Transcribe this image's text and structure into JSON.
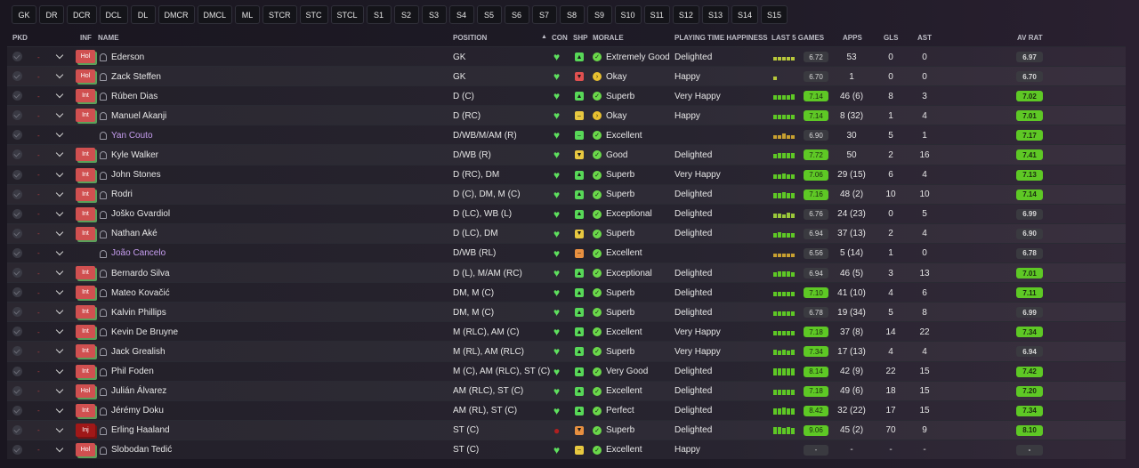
{
  "position_filters": [
    "GK",
    "DR",
    "DCR",
    "DCL",
    "DL",
    "DMCR",
    "DMCL",
    "ML",
    "STCR",
    "STC",
    "STCL",
    "S1",
    "S2",
    "S3",
    "S4",
    "S5",
    "S6",
    "S7",
    "S8",
    "S9",
    "S10",
    "S11",
    "S12",
    "S13",
    "S14",
    "S15"
  ],
  "headers": {
    "pkd": "PKD",
    "inf": "INF",
    "name": "NAME",
    "position": "POSITION",
    "sort_arrow": "▲",
    "con": "CON",
    "shp": "SHP",
    "morale": "MORALE",
    "pth": "PLAYING TIME HAPPINESS",
    "last5": "LAST 5 GAMES",
    "apps": "APPS",
    "gls": "GLS",
    "ast": "AST",
    "avrat": "AV RAT"
  },
  "colors": {
    "rating_green": "#5ec825",
    "rating_yellowgreen": "#b8c83a",
    "rating_grey": "#3a3a40",
    "shp_green": "#58d858",
    "shp_red": "#e05050",
    "shp_yellow": "#e8c840",
    "shp_orange": "#e89040",
    "morale_green": "#6ad84a",
    "morale_yellow": "#e8c030"
  },
  "players": [
    {
      "inf": "Hol",
      "name": "Ederson",
      "loan": false,
      "position": "GK",
      "con_red": false,
      "shp": "green",
      "shp_icon": "▲",
      "morale": "Extremely Good",
      "morale_color": "green",
      "pth": "Delighted",
      "last5": [
        0.5,
        0.5,
        0.5,
        0.5,
        0.5
      ],
      "last5_color": "#b8c83a",
      "last5_rating": "6.72",
      "rating_style": "grey",
      "apps": "53",
      "gls": "0",
      "ast": "0",
      "avrat": "6.97",
      "av_style": "grey"
    },
    {
      "inf": "Hol",
      "name": "Zack Steffen",
      "loan": false,
      "position": "GK",
      "con_red": false,
      "shp": "red",
      "shp_icon": "▼",
      "morale": "Okay",
      "morale_color": "yellow",
      "pth": "Happy",
      "last5": [
        0.5
      ],
      "last5_color": "#b8c83a",
      "last5_rating": "6.70",
      "rating_style": "grey",
      "apps": "1",
      "gls": "0",
      "ast": "0",
      "avrat": "6.70",
      "av_style": "grey"
    },
    {
      "inf": "Int",
      "name": "Rúben Dias",
      "loan": false,
      "position": "D (C)",
      "con_red": false,
      "shp": "green",
      "shp_icon": "▲",
      "morale": "Superb",
      "morale_color": "green",
      "pth": "Very Happy",
      "last5": [
        0.7,
        0.7,
        0.7,
        0.7,
        0.8
      ],
      "last5_color": "#5ec825",
      "last5_rating": "7.14",
      "rating_style": "green",
      "apps": "46 (6)",
      "gls": "8",
      "ast": "3",
      "avrat": "7.02",
      "av_style": "green"
    },
    {
      "inf": "Int",
      "name": "Manuel Akanji",
      "loan": false,
      "position": "D (RC)",
      "con_red": false,
      "shp": "yellow",
      "shp_icon": "–",
      "morale": "Okay",
      "morale_color": "yellow",
      "pth": "Happy",
      "last5": [
        0.7,
        0.7,
        0.7,
        0.7,
        0.7
      ],
      "last5_color": "#5ec825",
      "last5_rating": "7.14",
      "rating_style": "green",
      "apps": "8 (32)",
      "gls": "1",
      "ast": "4",
      "avrat": "7.01",
      "av_style": "green"
    },
    {
      "inf": "",
      "name": "Yan Couto",
      "loan": true,
      "position": "D/WB/M/AM (R)",
      "con_red": false,
      "shp": "green",
      "shp_icon": "–",
      "morale": "Excellent",
      "morale_color": "green",
      "pth": "",
      "last5": [
        0.5,
        0.6,
        0.8,
        0.6,
        0.5
      ],
      "last5_color": "#c8a030",
      "last5_rating": "6.90",
      "rating_style": "grey",
      "apps": "30",
      "gls": "5",
      "ast": "1",
      "avrat": "7.17",
      "av_style": "green"
    },
    {
      "inf": "Int",
      "name": "Kyle Walker",
      "loan": false,
      "position": "D/WB (R)",
      "con_red": false,
      "shp": "yellow",
      "shp_icon": "▼",
      "morale": "Good",
      "morale_color": "green",
      "pth": "Delighted",
      "last5": [
        0.7,
        0.8,
        0.8,
        0.8,
        0.8
      ],
      "last5_color": "#5ec825",
      "last5_rating": "7.72",
      "rating_style": "green",
      "apps": "50",
      "gls": "2",
      "ast": "16",
      "avrat": "7.41",
      "av_style": "green"
    },
    {
      "inf": "Int",
      "name": "John Stones",
      "loan": false,
      "position": "D (RC), DM",
      "con_red": false,
      "shp": "green",
      "shp_icon": "▲",
      "morale": "Superb",
      "morale_color": "green",
      "pth": "Very Happy",
      "last5": [
        0.6,
        0.6,
        0.7,
        0.6,
        0.6
      ],
      "last5_color": "#5ec825",
      "last5_rating": "7.06",
      "rating_style": "green",
      "apps": "29 (15)",
      "gls": "6",
      "ast": "4",
      "avrat": "7.13",
      "av_style": "green"
    },
    {
      "inf": "Int",
      "name": "Rodri",
      "loan": false,
      "position": "D (C), DM, M (C)",
      "con_red": false,
      "shp": "green",
      "shp_icon": "▲",
      "morale": "Superb",
      "morale_color": "green",
      "pth": "Delighted",
      "last5": [
        0.7,
        0.7,
        0.8,
        0.7,
        0.7
      ],
      "last5_color": "#5ec825",
      "last5_rating": "7.16",
      "rating_style": "green",
      "apps": "48 (2)",
      "gls": "10",
      "ast": "10",
      "avrat": "7.14",
      "av_style": "green"
    },
    {
      "inf": "Int",
      "name": "Joško Gvardiol",
      "loan": false,
      "position": "D (LC), WB (L)",
      "con_red": false,
      "shp": "green",
      "shp_icon": "▲",
      "morale": "Exceptional",
      "morale_color": "green",
      "pth": "Delighted",
      "last5": [
        0.6,
        0.6,
        0.5,
        0.7,
        0.6
      ],
      "last5_color": "#9ac83a",
      "last5_rating": "6.76",
      "rating_style": "grey",
      "apps": "24 (23)",
      "gls": "0",
      "ast": "5",
      "avrat": "6.99",
      "av_style": "grey"
    },
    {
      "inf": "Int",
      "name": "Nathan Aké",
      "loan": false,
      "position": "D (LC), DM",
      "con_red": false,
      "shp": "yellow",
      "shp_icon": "▼",
      "morale": "Superb",
      "morale_color": "green",
      "pth": "Delighted",
      "last5": [
        0.6,
        0.7,
        0.6,
        0.6,
        0.6
      ],
      "last5_color": "#5ec825",
      "last5_rating": "6.94",
      "rating_style": "grey",
      "apps": "37 (13)",
      "gls": "2",
      "ast": "4",
      "avrat": "6.90",
      "av_style": "grey"
    },
    {
      "inf": "",
      "name": "João Cancelo",
      "loan": true,
      "position": "D/WB (RL)",
      "con_red": false,
      "shp": "orange",
      "shp_icon": "–",
      "morale": "Excellent",
      "morale_color": "green",
      "pth": "",
      "last5": [
        0.5,
        0.5,
        0.5,
        0.5,
        0.5
      ],
      "last5_color": "#c8a030",
      "last5_rating": "6.56",
      "rating_style": "grey",
      "apps": "5 (14)",
      "gls": "1",
      "ast": "0",
      "avrat": "6.78",
      "av_style": "grey"
    },
    {
      "inf": "Int",
      "name": "Bernardo Silva",
      "loan": false,
      "position": "D (L), M/AM (RC)",
      "con_red": false,
      "shp": "green",
      "shp_icon": "▲",
      "morale": "Exceptional",
      "morale_color": "green",
      "pth": "Delighted",
      "last5": [
        0.6,
        0.7,
        0.7,
        0.7,
        0.6
      ],
      "last5_color": "#5ec825",
      "last5_rating": "6.94",
      "rating_style": "grey",
      "apps": "46 (5)",
      "gls": "3",
      "ast": "13",
      "avrat": "7.01",
      "av_style": "green"
    },
    {
      "inf": "Int",
      "name": "Mateo Kovačić",
      "loan": false,
      "position": "DM, M (C)",
      "con_red": false,
      "shp": "green",
      "shp_icon": "▲",
      "morale": "Superb",
      "morale_color": "green",
      "pth": "Delighted",
      "last5": [
        0.7,
        0.7,
        0.7,
        0.7,
        0.7
      ],
      "last5_color": "#5ec825",
      "last5_rating": "7.10",
      "rating_style": "green",
      "apps": "41 (10)",
      "gls": "4",
      "ast": "6",
      "avrat": "7.11",
      "av_style": "green"
    },
    {
      "inf": "Int",
      "name": "Kalvin Phillips",
      "loan": false,
      "position": "DM, M (C)",
      "con_red": false,
      "shp": "green",
      "shp_icon": "▲",
      "morale": "Superb",
      "morale_color": "green",
      "pth": "Delighted",
      "last5": [
        0.6,
        0.6,
        0.6,
        0.6,
        0.6
      ],
      "last5_color": "#5ec825",
      "last5_rating": "6.78",
      "rating_style": "grey",
      "apps": "19 (34)",
      "gls": "5",
      "ast": "8",
      "avrat": "6.99",
      "av_style": "grey"
    },
    {
      "inf": "Int",
      "name": "Kevin De Bruyne",
      "loan": false,
      "position": "M (RLC), AM (C)",
      "con_red": false,
      "shp": "green",
      "shp_icon": "▲",
      "morale": "Excellent",
      "morale_color": "green",
      "pth": "Very Happy",
      "last5": [
        0.7,
        0.7,
        0.7,
        0.7,
        0.7
      ],
      "last5_color": "#5ec825",
      "last5_rating": "7.18",
      "rating_style": "green",
      "apps": "37 (8)",
      "gls": "14",
      "ast": "22",
      "avrat": "7.34",
      "av_style": "green"
    },
    {
      "inf": "Int",
      "name": "Jack Grealish",
      "loan": false,
      "position": "M (RL), AM (RLC)",
      "con_red": false,
      "shp": "green",
      "shp_icon": "▲",
      "morale": "Superb",
      "morale_color": "green",
      "pth": "Very Happy",
      "last5": [
        0.8,
        0.7,
        0.8,
        0.7,
        0.8
      ],
      "last5_color": "#5ec825",
      "last5_rating": "7.34",
      "rating_style": "green",
      "apps": "17 (13)",
      "gls": "4",
      "ast": "4",
      "avrat": "6.94",
      "av_style": "grey"
    },
    {
      "inf": "Int",
      "name": "Phil Foden",
      "loan": false,
      "position": "M (C), AM (RLC), ST (C)",
      "con_red": false,
      "shp": "green",
      "shp_icon": "▲",
      "morale": "Very Good",
      "morale_color": "green",
      "pth": "Delighted",
      "last5": [
        1.0,
        0.9,
        0.9,
        0.9,
        0.9
      ],
      "last5_color": "#5ec825",
      "last5_rating": "8.14",
      "rating_style": "green",
      "apps": "42 (9)",
      "gls": "22",
      "ast": "15",
      "avrat": "7.42",
      "av_style": "green"
    },
    {
      "inf": "Hol",
      "name": "Julián Álvarez",
      "loan": false,
      "position": "AM (RLC), ST (C)",
      "con_red": false,
      "shp": "green",
      "shp_icon": "▲",
      "morale": "Excellent",
      "morale_color": "green",
      "pth": "Delighted",
      "last5": [
        0.7,
        0.7,
        0.7,
        0.7,
        0.7
      ],
      "last5_color": "#5ec825",
      "last5_rating": "7.18",
      "rating_style": "green",
      "apps": "49 (6)",
      "gls": "18",
      "ast": "15",
      "avrat": "7.20",
      "av_style": "green"
    },
    {
      "inf": "Int",
      "name": "Jérémy Doku",
      "loan": false,
      "position": "AM (RL), ST (C)",
      "con_red": false,
      "shp": "green",
      "shp_icon": "▲",
      "morale": "Perfect",
      "morale_color": "green",
      "pth": "Delighted",
      "last5": [
        0.9,
        0.9,
        1.0,
        0.9,
        0.9
      ],
      "last5_color": "#5ec825",
      "last5_rating": "8.42",
      "rating_style": "green",
      "apps": "32 (22)",
      "gls": "17",
      "ast": "15",
      "avrat": "7.34",
      "av_style": "green"
    },
    {
      "inf": "Inj",
      "name": "Erling Haaland",
      "loan": false,
      "position": "ST (C)",
      "con_red": true,
      "shp": "orange",
      "shp_icon": "▼",
      "morale": "Superb",
      "morale_color": "green",
      "pth": "Delighted",
      "last5": [
        1.0,
        1.0,
        0.9,
        1.0,
        0.9
      ],
      "last5_color": "#5ec825",
      "last5_rating": "9.06",
      "rating_style": "green",
      "apps": "45 (2)",
      "gls": "70",
      "ast": "9",
      "avrat": "8.10",
      "av_style": "green"
    },
    {
      "inf": "Hol",
      "name": "Slobodan Tedić",
      "loan": false,
      "position": "ST (C)",
      "con_red": false,
      "shp": "yellow",
      "shp_icon": "–",
      "morale": "Excellent",
      "morale_color": "green",
      "pth": "Happy",
      "last5": [],
      "last5_color": "#5ec825",
      "last5_rating": "-",
      "rating_style": "grey",
      "apps": "-",
      "gls": "-",
      "ast": "-",
      "avrat": "-",
      "av_style": "grey"
    }
  ]
}
